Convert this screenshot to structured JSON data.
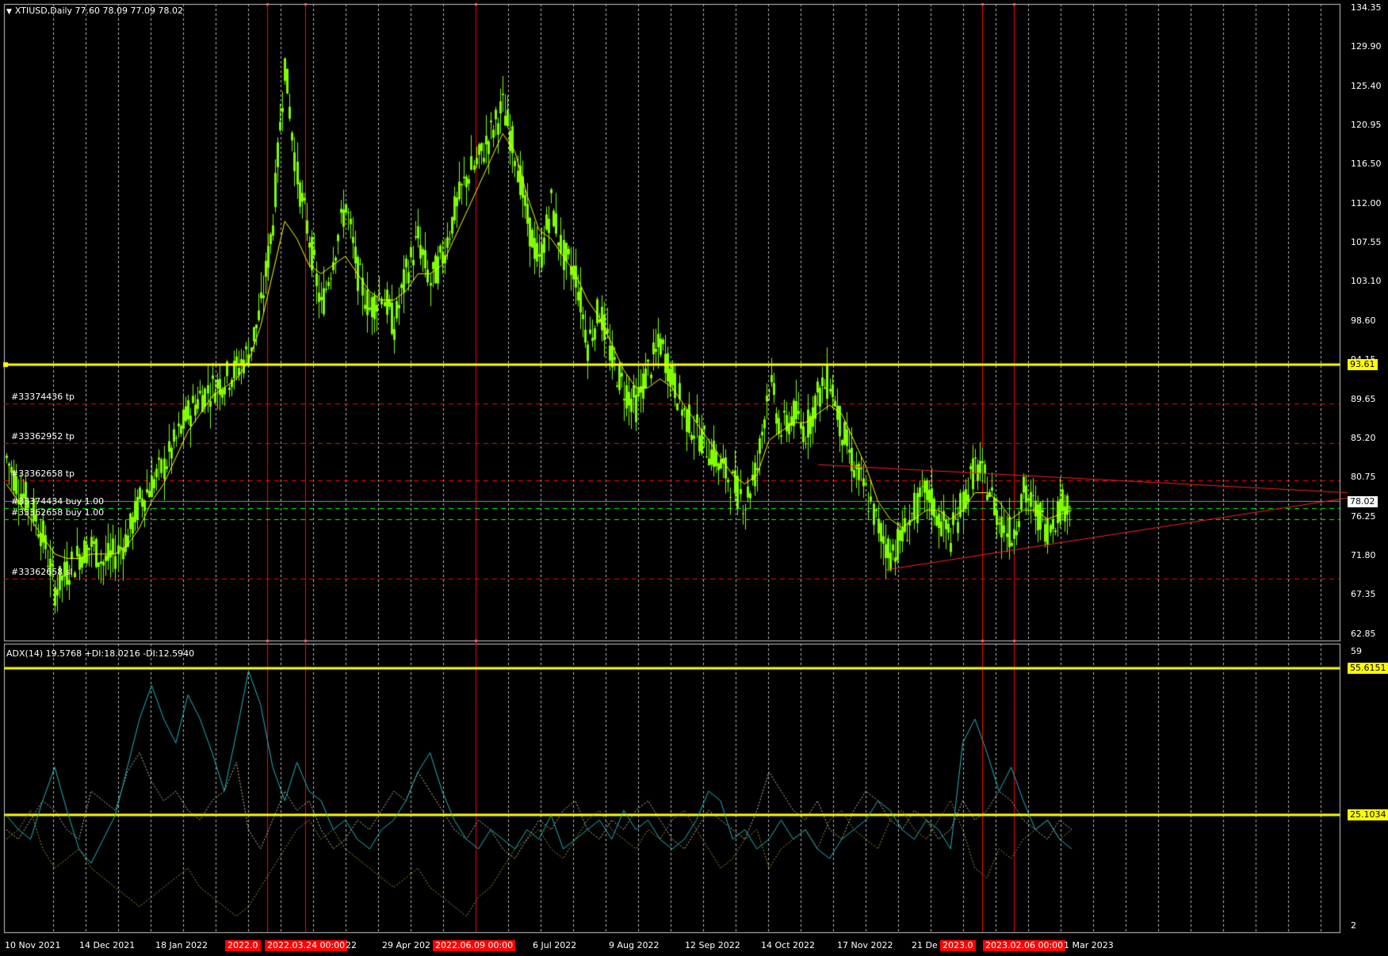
{
  "chart_title": "XTIUSD,Daily  77.60 78.09 77.09 78.02",
  "adx_title": "ADX(14) 19.5768 +DI:18.0216 -DI:12.5940",
  "colors": {
    "background": "#000000",
    "grid": "#c8c8c8",
    "candle": "#7fff00",
    "ma": "#ffff00",
    "hline": "#ffff00",
    "order_line": "#ff0000",
    "entry_line": "#00ff00",
    "vline": "#ff0000",
    "adx_main": "#1fb6c0",
    "di_plus": "#c8c89a",
    "di_minus": "#9a9a40"
  },
  "price_axis": [
    "134.35",
    "129.90",
    "125.40",
    "120.95",
    "116.50",
    "112.00",
    "107.55",
    "103.10",
    "98.60",
    "94.15",
    "89.65",
    "85.20",
    "80.75",
    "76.25",
    "71.80",
    "67.35",
    "62.85"
  ],
  "adx_axis": [
    "59",
    "2"
  ],
  "time_axis": [
    "10 Nov 2021",
    "14 Dec 2021",
    "18 Jan 2022",
    "2022.0",
    "2022.03.24 00:00",
    "22",
    "29 Apr 202",
    "2022.06.09 00:00",
    "6 Jul 2022",
    "9 Aug 2022",
    "12 Sep 2022",
    "14 Oct 2022",
    "17 Nov 2022",
    "21 De",
    "2023.0",
    "2023.02.06 00:00",
    "1 Mar 2023"
  ],
  "orders": [
    {
      "label": "#33374436 tp",
      "price": 89.2
    },
    {
      "label": "#33362952 tp",
      "price": 84.7
    },
    {
      "label": "#33362658 tp",
      "price": 80.4
    },
    {
      "label": "#33374434 buy 1.00",
      "price": 77.2
    },
    {
      "label": "#33362658 buy 1.00",
      "price": 76.0
    },
    {
      "label": "#33362658 sl",
      "price": 69.2
    }
  ],
  "horizontal_levels": {
    "resistance": "93.61",
    "adx_high": "55.6151",
    "adx_low": "25.1034"
  },
  "current_price": "78.02",
  "chart_data": {
    "type": "candlestick",
    "symbol": "XTIUSD",
    "timeframe": "Daily",
    "ylim": [
      62.85,
      134.35
    ],
    "close_series": [
      83.0,
      79.5,
      77.5,
      74.0,
      68.0,
      70.0,
      72.0,
      73.0,
      71.0,
      72.0,
      74.0,
      78.0,
      80.0,
      82.0,
      85.0,
      88.0,
      90.0,
      91.0,
      92.0,
      93.0,
      95.0,
      100.0,
      110.0,
      128.0,
      115.0,
      108.0,
      100.0,
      106.0,
      112.0,
      104.0,
      100.0,
      102.0,
      98.0,
      104.0,
      108.0,
      103.0,
      106.0,
      111.0,
      115.0,
      117.0,
      120.0,
      123.0,
      118.0,
      110.0,
      105.0,
      112.0,
      106.0,
      104.0,
      96.0,
      100.0,
      94.0,
      91.0,
      89.0,
      93.0,
      96.0,
      92.0,
      88.0,
      86.0,
      84.0,
      82.0,
      80.0,
      78.0,
      82.0,
      92.0,
      86.0,
      88.0,
      86.0,
      90.0,
      92.0,
      86.0,
      82.0,
      79.0,
      75.0,
      72.0,
      74.0,
      77.0,
      79.0,
      76.0,
      74.0,
      78.0,
      82.0,
      80.0,
      76.0,
      74.0,
      79.0,
      77.0,
      75.0,
      77.5,
      78.0
    ],
    "ma_series": [
      80.0,
      78.0,
      76.0,
      74.0,
      72.0,
      71.5,
      71.5,
      72.0,
      72.0,
      72.0,
      73.0,
      75.0,
      78.0,
      80.0,
      83.0,
      86.0,
      88.0,
      90.0,
      91.0,
      92.0,
      94.0,
      98.0,
      104.0,
      110.0,
      108.0,
      105.0,
      104.0,
      105.0,
      106.0,
      104.0,
      102.0,
      101.0,
      101.0,
      102.0,
      104.0,
      104.0,
      105.0,
      108.0,
      111.0,
      114.0,
      117.0,
      120.0,
      118.0,
      113.0,
      109.0,
      108.0,
      106.0,
      104.0,
      101.0,
      99.0,
      96.0,
      93.0,
      91.0,
      91.0,
      92.0,
      91.0,
      89.0,
      87.0,
      85.0,
      83.0,
      81.0,
      80.0,
      81.0,
      85.0,
      86.0,
      87.0,
      87.0,
      88.0,
      89.0,
      88.0,
      85.0,
      82.0,
      78.0,
      76.0,
      75.0,
      76.0,
      77.0,
      77.0,
      76.0,
      77.0,
      79.0,
      79.0,
      78.0,
      76.0,
      77.0,
      77.0,
      76.0,
      76.5,
      77.0
    ]
  },
  "adx_data": {
    "ylim": [
      2,
      59
    ],
    "adx": [
      25,
      22,
      20,
      28,
      35,
      26,
      18,
      15,
      20,
      25,
      35,
      45,
      52,
      45,
      40,
      50,
      45,
      38,
      30,
      42,
      55,
      48,
      35,
      28,
      36,
      30,
      28,
      22,
      24,
      20,
      18,
      22,
      24,
      28,
      34,
      38,
      30,
      24,
      20,
      18,
      22,
      20,
      18,
      22,
      20,
      25,
      18,
      20,
      22,
      24,
      20,
      26,
      22,
      24,
      20,
      18,
      20,
      24,
      30,
      28,
      20,
      22,
      18,
      20,
      24,
      20,
      22,
      18,
      16,
      20,
      22,
      24,
      28,
      26,
      22,
      20,
      24,
      22,
      18,
      40,
      45,
      38,
      30,
      35,
      28,
      22,
      24,
      20,
      18
    ],
    "di_plus": [
      22,
      20,
      24,
      28,
      26,
      22,
      20,
      30,
      28,
      26,
      34,
      38,
      32,
      28,
      30,
      26,
      24,
      28,
      30,
      36,
      22,
      18,
      24,
      30,
      26,
      28,
      22,
      18,
      20,
      24,
      22,
      26,
      30,
      28,
      34,
      30,
      26,
      22,
      20,
      24,
      22,
      18,
      16,
      20,
      24,
      22,
      26,
      28,
      22,
      20,
      24,
      22,
      26,
      28,
      24,
      20,
      18,
      22,
      26,
      24,
      22,
      20,
      26,
      34,
      30,
      26,
      24,
      28,
      22,
      20,
      26,
      30,
      28,
      24,
      22,
      26,
      24,
      20,
      22,
      28,
      24,
      26,
      30,
      28,
      24,
      22,
      20,
      24,
      22
    ],
    "di_minus": [
      20,
      22,
      26,
      18,
      14,
      16,
      18,
      14,
      12,
      10,
      8,
      6,
      8,
      10,
      12,
      14,
      10,
      8,
      6,
      4,
      6,
      10,
      14,
      18,
      22,
      24,
      20,
      22,
      18,
      16,
      14,
      12,
      10,
      12,
      14,
      10,
      8,
      6,
      4,
      8,
      10,
      14,
      18,
      20,
      22,
      18,
      16,
      20,
      24,
      26,
      22,
      20,
      18,
      22,
      20,
      24,
      26,
      22,
      18,
      14,
      16,
      20,
      22,
      14,
      18,
      20,
      22,
      18,
      24,
      26,
      22,
      20,
      18,
      24,
      26,
      22,
      20,
      24,
      28,
      22,
      14,
      12,
      18,
      16,
      20,
      22,
      24,
      20,
      22
    ]
  }
}
